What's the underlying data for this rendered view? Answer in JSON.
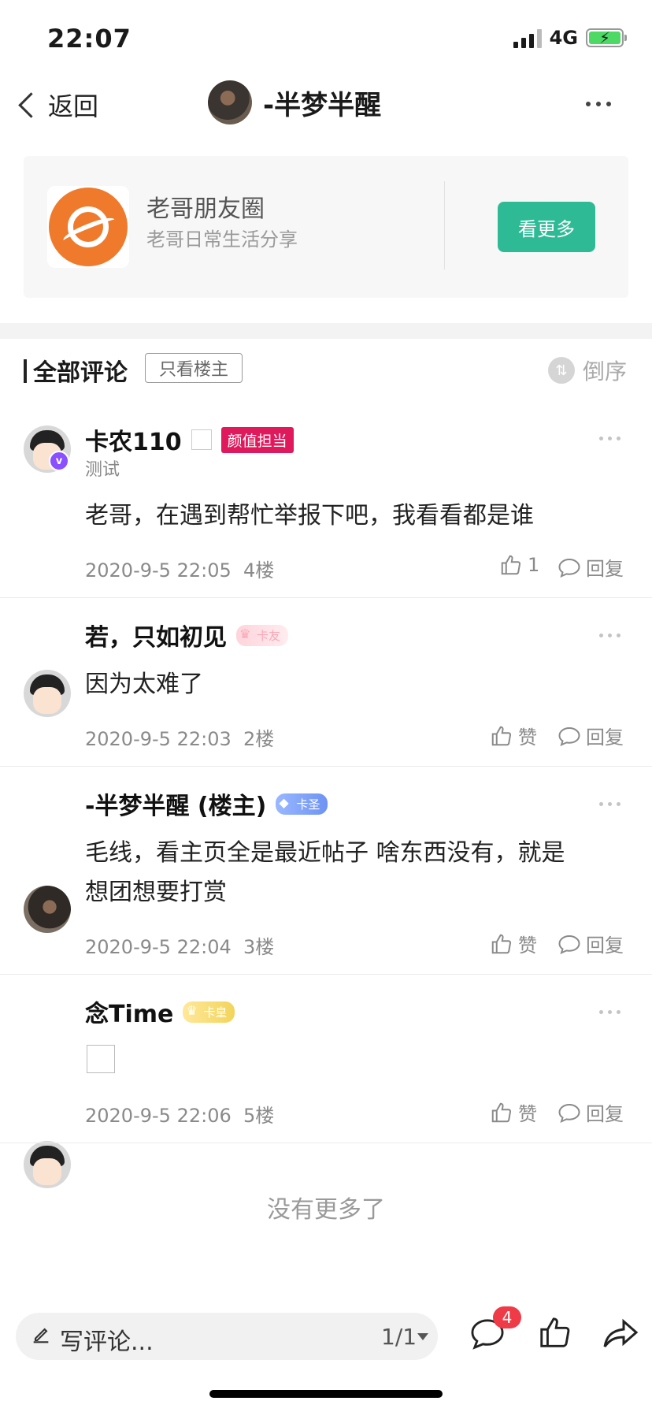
{
  "status_bar": {
    "time": "22:07",
    "network": "4G"
  },
  "nav": {
    "back_label": "返回",
    "title": "-半梦半醒"
  },
  "circle": {
    "name": "老哥朋友圈",
    "desc": "老哥日常生活分享",
    "more_label": "看更多",
    "accent": "#2fba96"
  },
  "comments_header": {
    "title": "全部评论",
    "filter_label": "只看楼主",
    "sort_label": "倒序"
  },
  "comments": [
    {
      "user": "卡农110",
      "title": "测试",
      "tag": "颜值担当",
      "text": "老哥，在遇到帮忙举报下吧，我看看都是谁",
      "time": "2020-9-5 22:05",
      "floor": "4楼",
      "like": "1",
      "reply": "回复"
    },
    {
      "user": "若，只如初见",
      "level": "卡友",
      "text": "因为太难了",
      "time": "2020-9-5 22:03",
      "floor": "2楼",
      "like": "赞",
      "reply": "回复"
    },
    {
      "user": "-半梦半醒 (楼主)",
      "level": "卡圣",
      "text_lines": [
        "毛线，看主页全是最近帖子 啥东西没有，就是",
        "想团想要打赏"
      ],
      "time": "2020-9-5 22:04",
      "floor": "3楼",
      "like": "赞",
      "reply": "回复"
    },
    {
      "user": "念Time",
      "level": "卡皇",
      "time": "2020-9-5 22:06",
      "floor": "5楼",
      "like": "赞",
      "reply": "回复"
    }
  ],
  "footer": {
    "no_more": "没有更多了"
  },
  "bottom_bar": {
    "placeholder": "写评论...",
    "page": "1/1",
    "comment_count": "4"
  }
}
